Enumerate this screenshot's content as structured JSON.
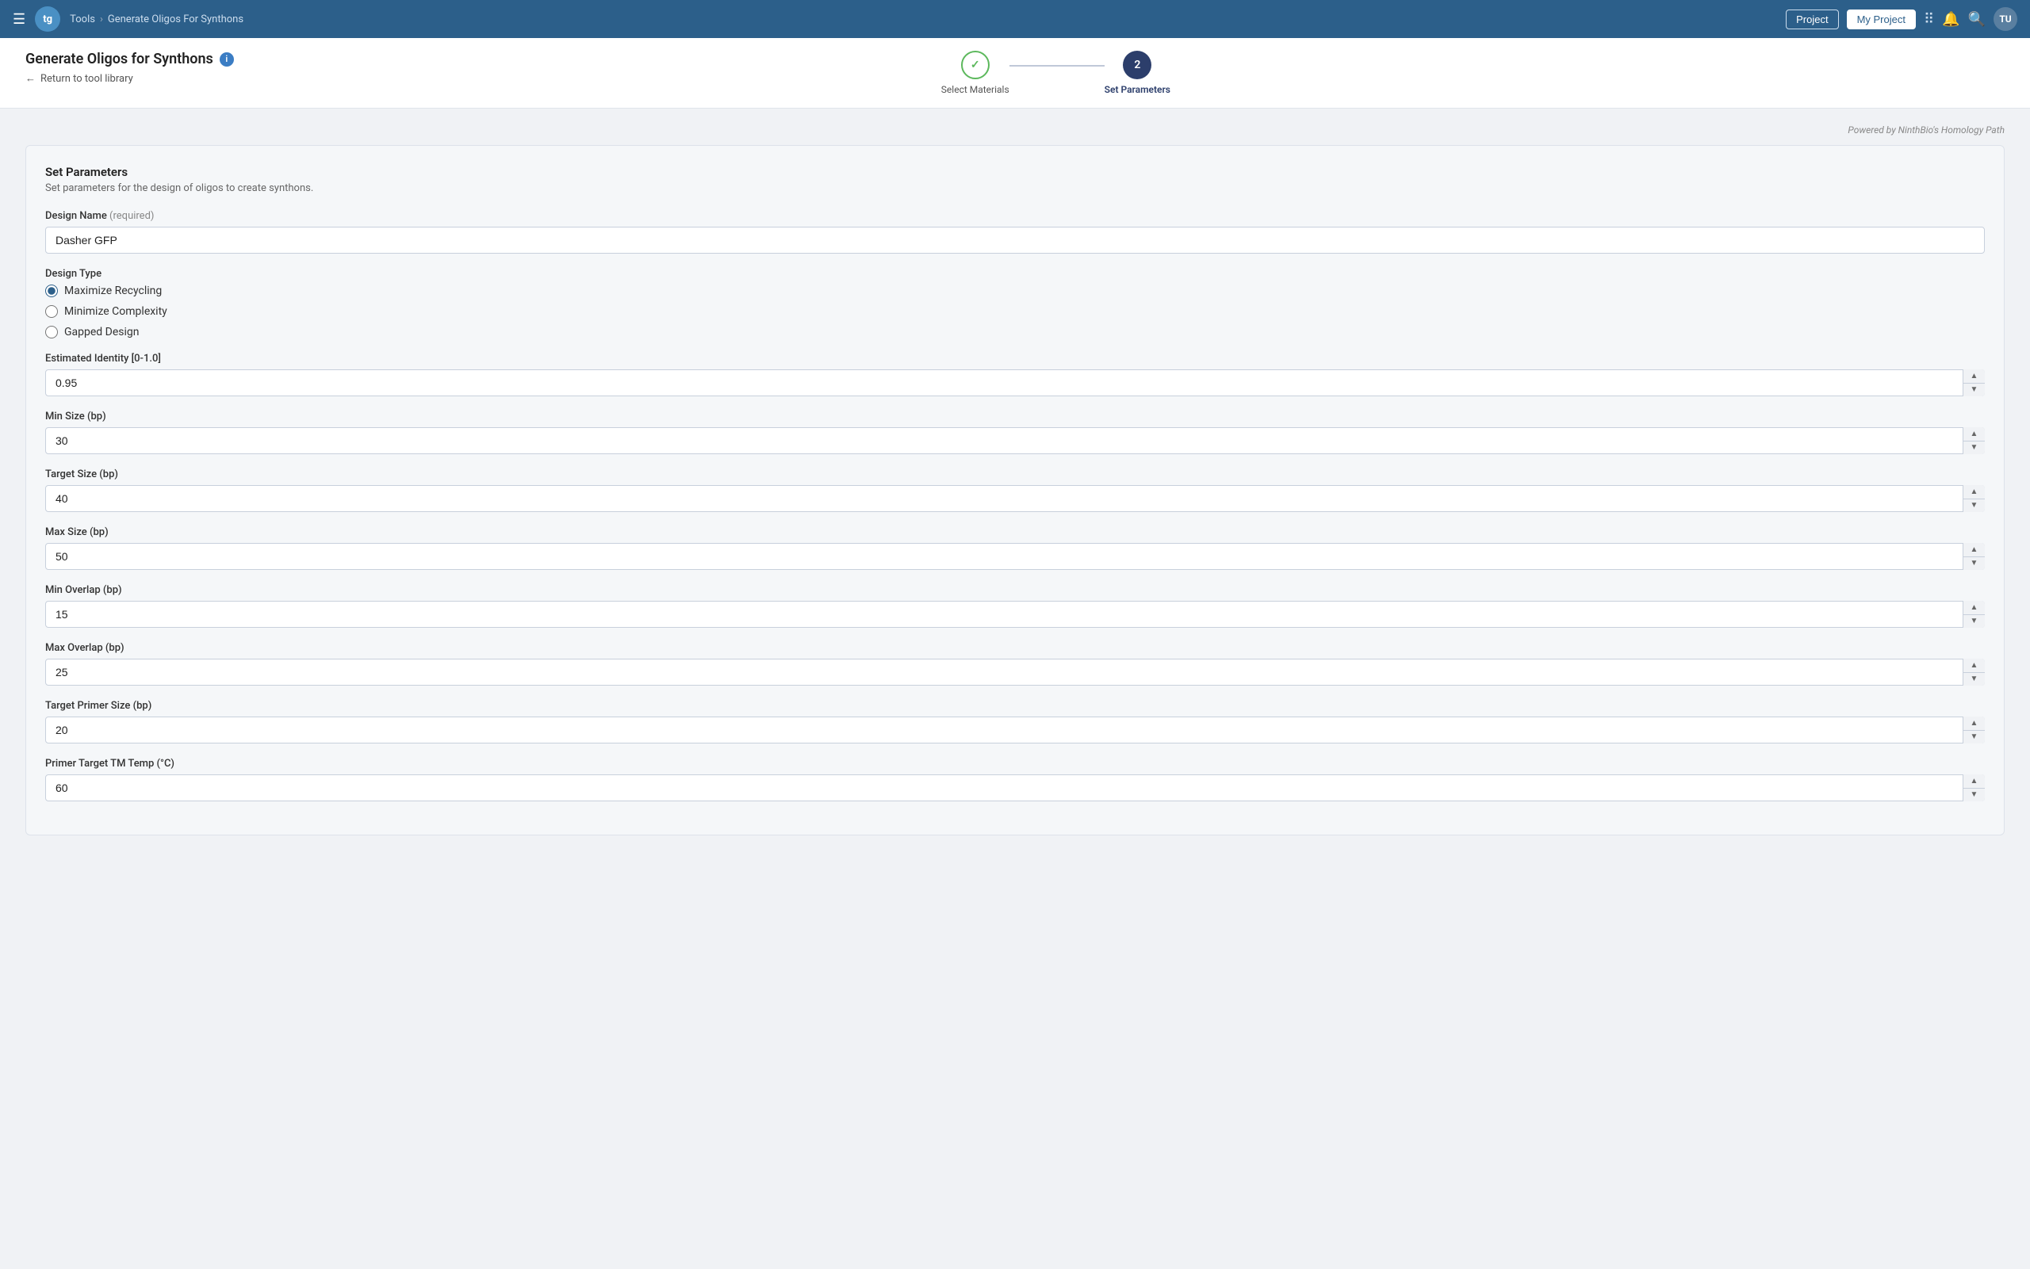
{
  "topnav": {
    "logo": "tg",
    "breadcrumb": [
      "Tools",
      "Generate Oligos For Synthons"
    ],
    "project_btn": "Project",
    "my_project_btn": "My Project",
    "avatar": "TU"
  },
  "page": {
    "title": "Generate Oligos for Synthons",
    "back_link": "Return to tool library",
    "powered_by": "Powered by NinthBio's Homology Path"
  },
  "stepper": {
    "steps": [
      {
        "id": "select-materials",
        "label": "Select Materials",
        "state": "completed",
        "number": "✓"
      },
      {
        "id": "set-parameters",
        "label": "Set Parameters",
        "state": "active",
        "number": "2"
      }
    ]
  },
  "form": {
    "section_title": "Set Parameters",
    "section_desc": "Set parameters for the design of oligos to create synthons.",
    "fields": {
      "design_name_label": "Design Name",
      "design_name_required": "(required)",
      "design_name_value": "Dasher GFP",
      "design_type_label": "Design Type",
      "design_type_options": [
        {
          "id": "maximize-recycling",
          "label": "Maximize Recycling",
          "checked": true
        },
        {
          "id": "minimize-complexity",
          "label": "Minimize Complexity",
          "checked": false
        },
        {
          "id": "gapped-design",
          "label": "Gapped Design",
          "checked": false
        }
      ],
      "estimated_identity_label": "Estimated Identity [0-1.0]",
      "estimated_identity_value": "0.95",
      "min_size_label": "Min Size (bp)",
      "min_size_value": "30",
      "target_size_label": "Target Size (bp)",
      "target_size_value": "40",
      "max_size_label": "Max Size (bp)",
      "max_size_value": "50",
      "min_overlap_label": "Min Overlap (bp)",
      "min_overlap_value": "15",
      "max_overlap_label": "Max Overlap (bp)",
      "max_overlap_value": "25",
      "target_primer_size_label": "Target Primer Size (bp)",
      "target_primer_size_value": "20",
      "primer_target_tm_label": "Primer Target TM Temp (°C)",
      "primer_target_tm_value": "60"
    }
  }
}
